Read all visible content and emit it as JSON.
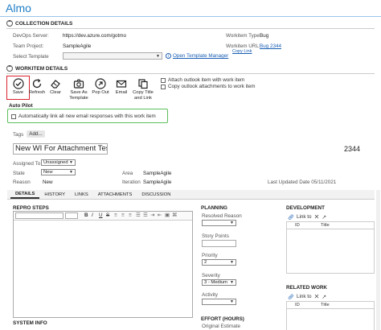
{
  "app": {
    "title": "Almo"
  },
  "collection": {
    "header": "COLLECTION DETAILS",
    "devops_label": "DevOps Server:",
    "devops_value": "https://dev.azure.com/gotmo",
    "project_label": "Team Project:",
    "project_value": "SampleAgile",
    "template_label": "Select Template",
    "template_link": "Open Template Manager",
    "wi_type_label": "Workitem Type:",
    "wi_type_value": "Bug",
    "wi_url_label": "Workitem URL:",
    "wi_url_value": "Bug 2344",
    "copy_link": "Copy Link"
  },
  "workitem": {
    "header": "WORKITEM DETAILS",
    "toolbar": {
      "save": "Save",
      "refresh": "Refresh",
      "clear": "Clear",
      "save_as_template": "Save As Template",
      "pop_out": "Pop Out",
      "email": "Email",
      "copy_title_link": "Copy Title and Link"
    },
    "attach_outlook": "Attach outlook item with work item",
    "copy_attachments": "Copy outlook attachments to work item",
    "autopilot_title": "Auto Pilot",
    "autopilot_option": "Automatically link all new email responses with this work item",
    "tags_label": "Tags",
    "tags_add": "Add...",
    "wi_title": "New WI For Attachment Test",
    "wi_id": "2344",
    "assigned_label": "Assigned To",
    "assigned_value": "Unassigned",
    "state_label": "State",
    "state_value": "New",
    "reason_label": "Reason",
    "reason_value": "New",
    "area_label": "Area",
    "area_value": "SampleAgile",
    "iteration_label": "Iteration",
    "iteration_value": "SampleAgile",
    "last_updated": "Last Updated Date  05/11/2021"
  },
  "tabs": [
    "DETAILS",
    "HISTORY",
    "LINKS",
    "ATTACHMENTS",
    "DISCUSSION"
  ],
  "details": {
    "repro_label": "REPRO STEPS",
    "system_info_label": "SYSTEM INFO",
    "planning_label": "PLANNING",
    "resolved_reason_label": "Resolved Reason",
    "story_points_label": "Story Points",
    "priority_label": "Priority",
    "priority_value": "2",
    "severity_label": "Severity",
    "severity_value": "3 - Medium",
    "activity_label": "Activity",
    "effort_label": "EFFORT (HOURS)",
    "original_estimate_label": "Original Estimate",
    "development_label": "DEVELOPMENT",
    "link_to": "Link to",
    "col_id": "ID",
    "col_title": "Title",
    "related_label": "RELATED WORK",
    "rte": {
      "bold": "B",
      "italic": "I",
      "underline": "U",
      "strike": "S"
    }
  },
  "colors": {
    "accent": "#1e7ec8",
    "save_border": "#d9232d",
    "autopilot_border": "#5bbf5b"
  }
}
